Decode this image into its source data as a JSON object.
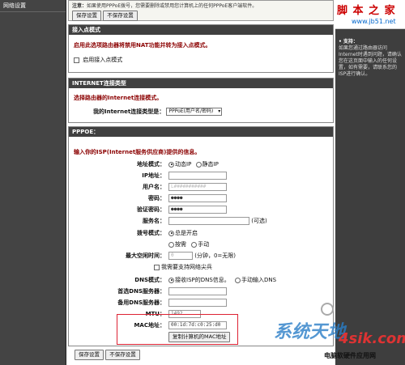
{
  "nav": {
    "top_item": "网络设置"
  },
  "top": {
    "note_prefix": "注意：",
    "note_text": "如果使用PPPoE拨号，您需要删除或禁用您计算机上的任何PPPoE客户端软件。",
    "save_label": "保存设置",
    "nosave_label": "不保存设置"
  },
  "ap": {
    "header": "接入点模式",
    "desc": "启用此选项路由器将禁用NAT功能并转为接入点模式。",
    "checkbox_label": "启用接入点模式"
  },
  "inet": {
    "header": "INTERNET连接类型",
    "desc": "选择路由器的Internet连接模式。",
    "type_label": "我的Internet连接类型是：",
    "type_value": "PPPoE(用户名/密码)"
  },
  "pppoe": {
    "header": "PPPOE：",
    "intro": "输入你的ISP(Internet服务供应商)提供的信息。",
    "addr_mode_label": "地址模式：",
    "addr_dynamic": "动态IP",
    "addr_static": "静态IP",
    "ip_label": "IP地址：",
    "user_label": "用户名：",
    "user_value": "L###########",
    "pwd_label": "密码：",
    "pwd_value": "●●●●",
    "verify_label": "验证密码：",
    "verify_value": "●●●●",
    "service_label": "服务名：",
    "service_optional": "(可选)",
    "dial_label": "拨号模式：",
    "dial_always": "总是开启",
    "dial_ondemand": "按需",
    "dial_manual": "手动",
    "idle_label": "最大空闲时间：",
    "idle_value": "0",
    "idle_unit": "(分钟，0=无限)",
    "proxy_text": "我需要支持网络尖兵",
    "dns_mode_label": "DNS模式：",
    "dns_from_isp": "接收ISP的DNS信息。",
    "dns_manual": "手动输入DNS",
    "dns1_label": "首选DNS服务器：",
    "dns2_label": "备用DNS服务器：",
    "mtu_label": "MTU：",
    "mtu_value": "1492",
    "mac_label": "MAC地址：",
    "mac_value": "00:1d:7d:c0:25:d0",
    "clone_label": "复制计算机的MAC地址"
  },
  "bottom": {
    "save_label": "保存设置",
    "nosave_label": "不保存设置"
  },
  "watermark": {
    "site_title": "脚 本 之 家",
    "site_url": "www.jb51.net",
    "logo_a": "系统天地",
    "logo_b": "4sik.com",
    "logo_sub": "电脑软硬件应用网"
  },
  "help": {
    "title": "• 支持：",
    "text": "如果您通过路由器访问Internet时遇到问题，请确认您在这页面中输入的任何设置，如有需要，请联系您的ISP进行确认。"
  },
  "colors": {
    "header_bg": "#404040",
    "red_text": "#8b0000",
    "highlight_box": "#d23"
  }
}
